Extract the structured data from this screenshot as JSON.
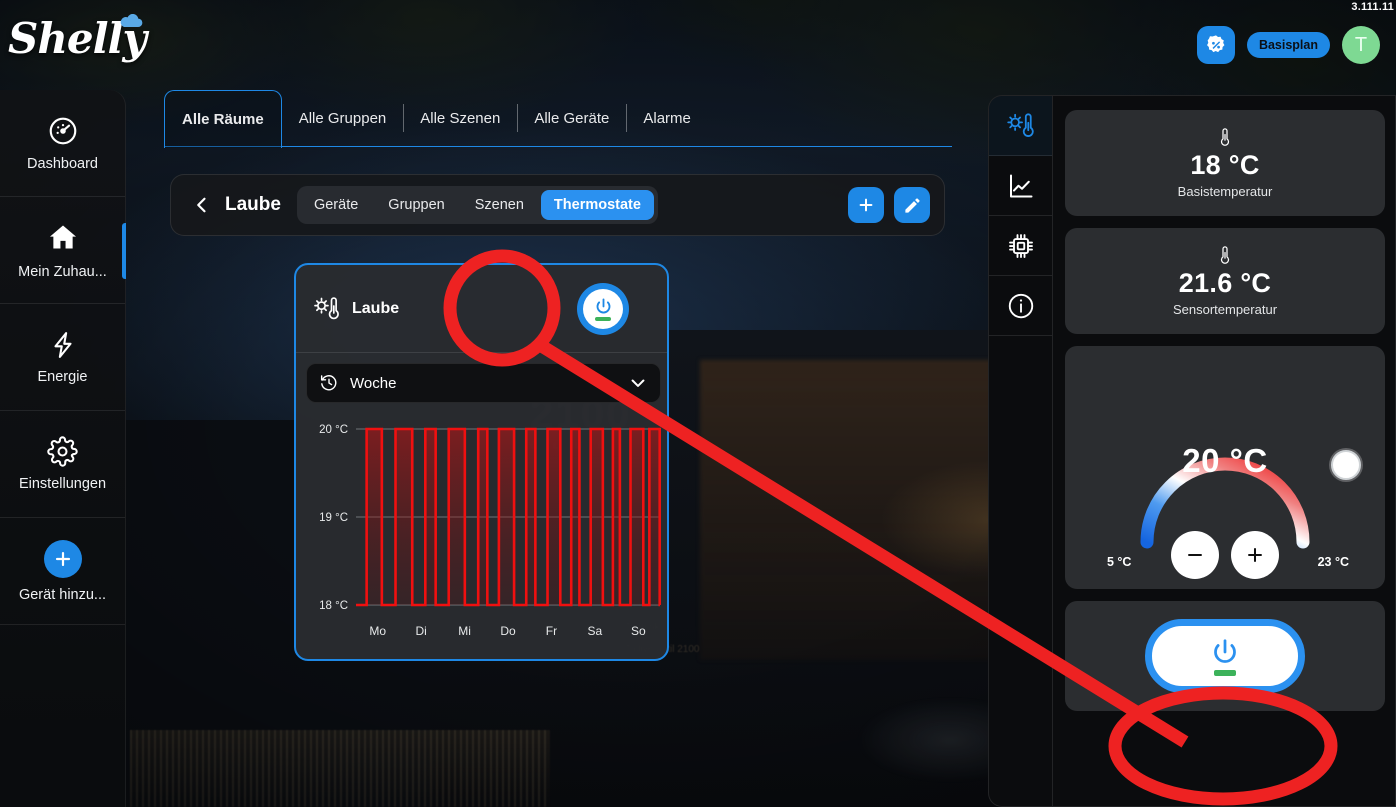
{
  "app": {
    "brand": "Shelly",
    "version": "3.111.11",
    "plan_label": "Basisplan",
    "avatar_initial": "T",
    "accent": "#1e88e5",
    "accent_light": "#2b91f0",
    "alert_red": "#ee2222",
    "green": "#3cb25a"
  },
  "sidebar": {
    "items": [
      {
        "label": "Dashboard",
        "icon": "dashboard-gauge-icon",
        "active": false
      },
      {
        "label": "Mein Zuhau...",
        "icon": "home-icon",
        "active": true
      },
      {
        "label": "Energie",
        "icon": "lightning-icon",
        "active": false
      },
      {
        "label": "Einstellungen",
        "icon": "gear-icon",
        "active": false
      },
      {
        "label": "Gerät hinzu...",
        "icon": "plus-circle-icon",
        "active": false
      }
    ]
  },
  "tabs": [
    {
      "label": "Alle Räume",
      "active": true
    },
    {
      "label": "Alle Gruppen",
      "active": false
    },
    {
      "label": "Alle Szenen",
      "active": false
    },
    {
      "label": "Alle Geräte",
      "active": false
    },
    {
      "label": "Alarme",
      "active": false
    }
  ],
  "subbar": {
    "back_icon": "chevron-left-icon",
    "room": "Laube",
    "chips": [
      {
        "label": "Geräte",
        "active": false
      },
      {
        "label": "Gruppen",
        "active": false
      },
      {
        "label": "Szenen",
        "active": false
      },
      {
        "label": "Thermostate",
        "active": true
      }
    ],
    "add_icon": "plus-icon",
    "edit_icon": "pencil-icon"
  },
  "thermostat_card": {
    "icon": "thermostat-sun-icon",
    "title": "Laube",
    "power_icon": "power-icon",
    "range": {
      "icon": "history-icon",
      "label": "Woche",
      "chevron": "chevron-down-icon"
    }
  },
  "chart_data": {
    "type": "line",
    "title": "",
    "xlabel": "",
    "ylabel": "",
    "ylim": [
      18,
      20
    ],
    "yticks": [
      18,
      19,
      20
    ],
    "ytick_labels": [
      "18 °C",
      "19 °C",
      "20 °C"
    ],
    "categories": [
      "Mo",
      "Di",
      "Mi",
      "Do",
      "Fr",
      "Sa",
      "So"
    ],
    "grid": true,
    "legend": false,
    "line_color": "#f01010",
    "fill_color": "rgba(180,20,20,0.28)",
    "description": "Square-wave target temperature schedule toggling between 18 °C and 20 °C",
    "pulses": [
      {
        "start": 0.035,
        "end": 0.085
      },
      {
        "start": 0.13,
        "end": 0.185
      },
      {
        "start": 0.228,
        "end": 0.262
      },
      {
        "start": 0.305,
        "end": 0.358
      },
      {
        "start": 0.402,
        "end": 0.432
      },
      {
        "start": 0.47,
        "end": 0.52
      },
      {
        "start": 0.56,
        "end": 0.59
      },
      {
        "start": 0.63,
        "end": 0.672
      },
      {
        "start": 0.708,
        "end": 0.735
      },
      {
        "start": 0.772,
        "end": 0.812
      },
      {
        "start": 0.845,
        "end": 0.868
      },
      {
        "start": 0.903,
        "end": 0.945
      },
      {
        "start": 0.965,
        "end": 0.999
      }
    ]
  },
  "right_panel": {
    "rail": [
      {
        "icon": "thermostat-sun-icon",
        "active": true
      },
      {
        "icon": "chart-line-icon",
        "active": false
      },
      {
        "icon": "chip-icon",
        "active": false
      },
      {
        "icon": "info-icon",
        "active": false
      }
    ],
    "stats": [
      {
        "icon": "thermometer-icon",
        "value": "18 °C",
        "caption": "Basistemperatur"
      },
      {
        "icon": "thermometer-icon",
        "value": "21.6 °C",
        "caption": "Sensortemperatur"
      }
    ],
    "gauge": {
      "value": "20 °C",
      "min_label": "5 °C",
      "max_label": "23 °C",
      "min": 5,
      "max": 23,
      "current": 20,
      "minus_icon": "minus-icon",
      "plus_icon": "plus-icon",
      "knob_icon": "gauge-knob-icon"
    },
    "power_card": {
      "power_icon": "power-icon",
      "state_on": true
    }
  },
  "annotations": {
    "circle_on_card_power": "red-highlight-circle",
    "ellipse_on_panel_power": "red-highlight-ellipse",
    "connector": "red-connector-line",
    "color": "#ee2222"
  }
}
